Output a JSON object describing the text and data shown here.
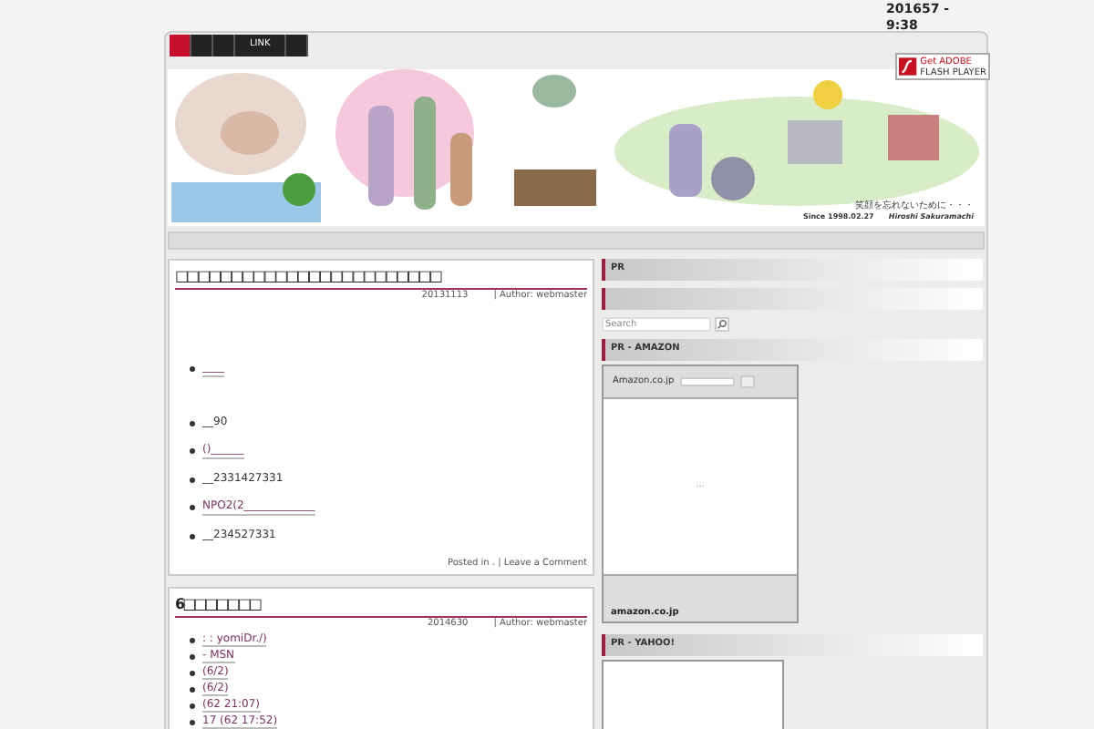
{
  "top_date": [
    "201657 -",
    "9:38"
  ],
  "nav": [
    {
      "selected": true
    },
    {
      "selected": false
    },
    {
      "selected": false
    },
    {
      "label": "LINK",
      "selected": false
    },
    {
      "selected": false
    }
  ],
  "header": {
    "kind": "picture",
    "caption": "笑顔を忘れないために・・・",
    "since": "Since 1998.02.27",
    "author": "Hiroshi Sakuramachi"
  },
  "flash_badge": {
    "line1": "Get ADOBE",
    "line2": "FLASH PLAYER"
  },
  "posts": [
    {
      "title": "□□□□□□□□□□□□□□□□□□□□□□□□",
      "date": "20131113",
      "author": "| Author: webmaster",
      "items": [
        {
          "text": "____",
          "link": true
        },
        {
          "text": "__90",
          "link": false
        },
        {
          "text": "()______",
          "link": true
        },
        {
          "text": "__2331427331",
          "link": false
        },
        {
          "text": "NPO2(2_____________",
          "link": true
        },
        {
          "text": "__234527331",
          "link": false
        }
      ],
      "footer": "Posted in .  | Leave a Comment"
    },
    {
      "title": "6□□□□□□□",
      "date": "2014630",
      "author": "| Author: webmaster",
      "items": [
        {
          "text": ": : yomiDr./)",
          "link": true
        },
        {
          "text": " - MSN",
          "link": true
        },
        {
          "text": "(6/2)",
          "link": true
        },
        {
          "text": "(6/2)",
          "link": true
        },
        {
          "text": " (62 21:07)",
          "link": true
        },
        {
          "text": "17 (62 17:52)",
          "link": true
        }
      ]
    }
  ],
  "sidebar": [
    {
      "kind": "heading",
      "title": "PR"
    },
    {
      "kind": "heading"
    },
    {
      "kind": "search",
      "placeholder": "Search"
    },
    {
      "kind": "heading",
      "title": "PR - AMAZON"
    },
    {
      "kind": "amazon",
      "label": "Amazon.co.jp",
      "body": "...",
      "logo": "amazon.co.jp"
    },
    {
      "kind": "heading",
      "title": "PR - YAHOO!"
    },
    {
      "kind": "frame"
    }
  ]
}
